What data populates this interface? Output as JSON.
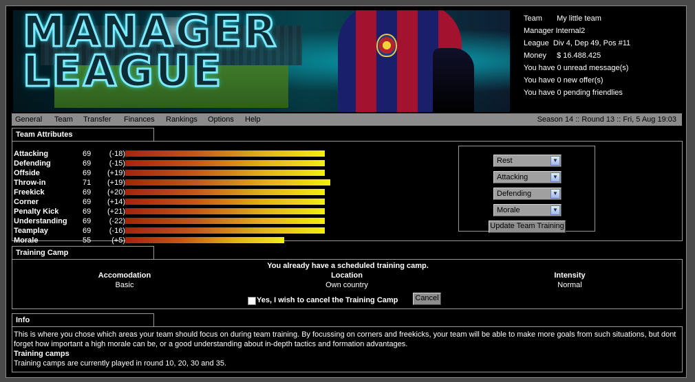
{
  "logo": {
    "line1": "MANAGER",
    "line2": "LEAGUE"
  },
  "team_info": {
    "team_key": "Team",
    "team_value": "My little team",
    "manager_key": "Manager",
    "manager_value": "Internal2",
    "league_key": "League",
    "league_value": "Div 4, Dep 49, Pos #11",
    "money_key": "Money",
    "money_value": "$ 16.488.425",
    "messages": "You have 0 unread message(s)",
    "offers": "You have 0 new offer(s)",
    "friendlies": "You have 0 pending friendlies"
  },
  "nav": {
    "general": "General",
    "team": "Team",
    "transfer": "Transfer",
    "finances": "Finances",
    "rankings": "Rankings",
    "options": "Options",
    "help": "Help",
    "season": "Season 14 :: Round 13 :: Fri, 5 Aug 19:03"
  },
  "team_attributes": {
    "title": "Team Attributes",
    "items": [
      {
        "name": "Attacking",
        "value": "69",
        "delta": "(-18)",
        "level": 69
      },
      {
        "name": "Defending",
        "value": "69",
        "delta": "(-15)",
        "level": 69
      },
      {
        "name": "Offside",
        "value": "69",
        "delta": "(+19)",
        "level": 69
      },
      {
        "name": "Throw-in",
        "value": "71",
        "delta": "(+19)",
        "level": 71
      },
      {
        "name": "Freekick",
        "value": "69",
        "delta": "(+20)",
        "level": 69
      },
      {
        "name": "Corner",
        "value": "69",
        "delta": "(+14)",
        "level": 69
      },
      {
        "name": "Penalty Kick",
        "value": "69",
        "delta": "(+21)",
        "level": 69
      },
      {
        "name": "Understanding",
        "value": "69",
        "delta": "(-22)",
        "level": 69
      },
      {
        "name": "Teamplay",
        "value": "69",
        "delta": "(-16)",
        "level": 69
      },
      {
        "name": "Morale",
        "value": "55",
        "delta": "(+5)",
        "level": 55
      }
    ]
  },
  "training": {
    "select1": "Rest",
    "select2": "Attacking",
    "select3": "Defending",
    "select4": "Morale",
    "update_label": "Update Team Training"
  },
  "training_camp": {
    "title": "Training Camp",
    "notice": "You already have a scheduled training camp.",
    "accommodation_label": "Accomodation",
    "accommodation_value": "Basic",
    "location_label": "Location",
    "location_value": "Own country",
    "intensity_label": "Intensity",
    "intensity_value": "Normal",
    "cancel_checkbox_label": "Yes, I wish to cancel the Training Camp",
    "cancel_button": "Cancel"
  },
  "info": {
    "title": "Info",
    "text": "This is where you chose which areas your team should focus on during team training. By focussing on corners and freekicks, your team will be able to make more goals from such situations, but dont forget how important a high morale can be, or a good understanding about in-depth tactics and formation advantages.",
    "subheading": "Training camps",
    "subtext": "Training camps are currently played in round 10, 20, 30 and 35."
  }
}
